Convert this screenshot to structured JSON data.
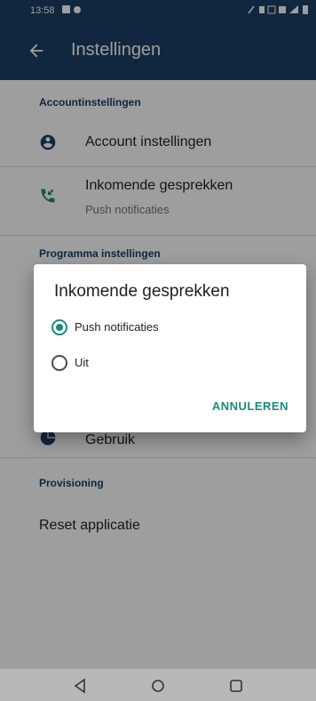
{
  "status_bar": {
    "time": "13:58"
  },
  "app_bar": {
    "title": "Instellingen"
  },
  "sections": {
    "account": {
      "header": "Accountinstellingen",
      "account_settings": "Account instellingen",
      "incoming_calls": {
        "title": "Inkomende gesprekken",
        "subtitle": "Push notificaties"
      }
    },
    "program": {
      "header": "Programma instellingen",
      "usage": "Gebruik"
    },
    "provisioning": {
      "header": "Provisioning",
      "reset": "Reset applicatie"
    }
  },
  "dialog": {
    "title": "Inkomende gesprekken",
    "options": [
      {
        "label": "Push notificaties",
        "selected": true
      },
      {
        "label": "Uit",
        "selected": false
      }
    ],
    "cancel_label": "ANNULEREN"
  },
  "colors": {
    "primary": "#1a3f66",
    "accent": "#1a8a7a"
  }
}
